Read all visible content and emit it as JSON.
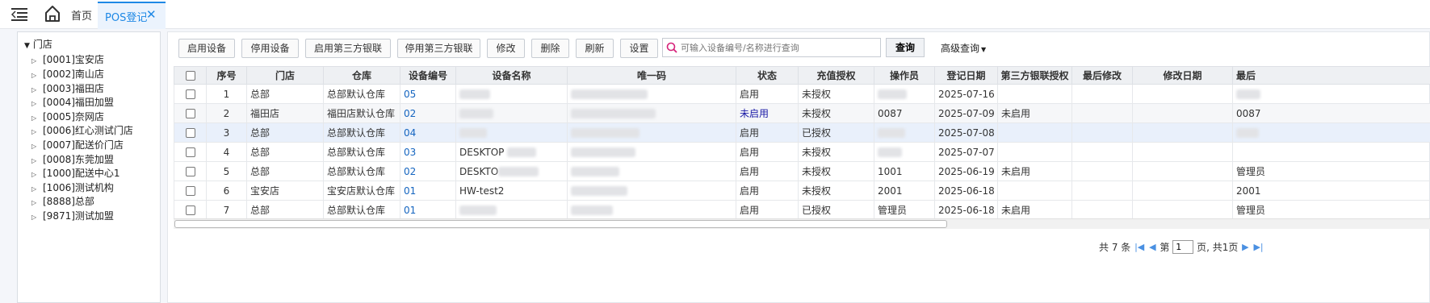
{
  "topbar": {
    "home_label": "首页",
    "active_tab_label": "POS登记",
    "close_glyph": "✕",
    "accent_color": "#1e88e5"
  },
  "tree": {
    "root_label": "门店",
    "items": [
      "[0001]宝安店",
      "[0002]南山店",
      "[0003]福田店",
      "[0004]福田加盟",
      "[0005]奈网店",
      "[0006]红心测试门店",
      "[0007]配送价门店",
      "[0008]东莞加盟",
      "[1000]配送中心1",
      "[1006]测试机构",
      "[8888]总部",
      "[9871]测试加盟"
    ]
  },
  "toolbar": {
    "buttons": [
      "启用设备",
      "停用设备",
      "启用第三方银联",
      "停用第三方银联",
      "修改",
      "删除",
      "刷新",
      "设置"
    ],
    "search_placeholder": "可输入设备编号/名称进行查询",
    "query_label": "查询",
    "advanced_label": "高级查询"
  },
  "table": {
    "headers": [
      "序号",
      "门店",
      "仓库",
      "设备编号",
      "设备名称",
      "唯一码",
      "状态",
      "充值授权",
      "操作员",
      "登记日期",
      "第三方银联授权",
      "最后修改",
      "修改日期",
      "最后"
    ],
    "rows": [
      {
        "idx": "1",
        "store": "总部",
        "warehouse": "总部默认仓库",
        "code": "05",
        "name": "",
        "status": "启用",
        "auth": "未授权",
        "operator": "",
        "date": "2025-07-16",
        "third": "",
        "last": ""
      },
      {
        "idx": "2",
        "store": "福田店",
        "warehouse": "福田店默认仓库",
        "code": "02",
        "name": "",
        "status": "未启用",
        "auth": "未授权",
        "operator": "0087",
        "date": "2025-07-09",
        "third": "未启用",
        "last": "0087"
      },
      {
        "idx": "3",
        "store": "总部",
        "warehouse": "总部默认仓库",
        "code": "04",
        "name": "",
        "status": "启用",
        "auth": "已授权",
        "operator": "",
        "date": "2025-07-08",
        "third": "",
        "last": ""
      },
      {
        "idx": "4",
        "store": "总部",
        "warehouse": "总部默认仓库",
        "code": "03",
        "name": "DESKTOP",
        "status": "启用",
        "auth": "未授权",
        "operator": "",
        "date": "2025-07-07",
        "third": "",
        "last": ""
      },
      {
        "idx": "5",
        "store": "总部",
        "warehouse": "总部默认仓库",
        "code": "02",
        "name": "DESKTO",
        "status": "启用",
        "auth": "未授权",
        "operator": "1001",
        "date": "2025-06-19",
        "third": "未启用",
        "last": "管理员"
      },
      {
        "idx": "6",
        "store": "宝安店",
        "warehouse": "宝安店默认仓库",
        "code": "01",
        "name": "HW-test2",
        "status": "启用",
        "auth": "未授权",
        "operator": "2001",
        "date": "2025-06-18",
        "third": "",
        "last": "2001"
      },
      {
        "idx": "7",
        "store": "总部",
        "warehouse": "总部默认仓库",
        "code": "01",
        "name": "",
        "status": "启用",
        "auth": "已授权",
        "operator": "管理员",
        "date": "2025-06-18",
        "third": "未启用",
        "last": "管理员"
      }
    ]
  },
  "pager": {
    "total_text": "共 7 条",
    "page_prefix": "第",
    "page_value": "1",
    "page_suffix": "页, 共1页"
  }
}
